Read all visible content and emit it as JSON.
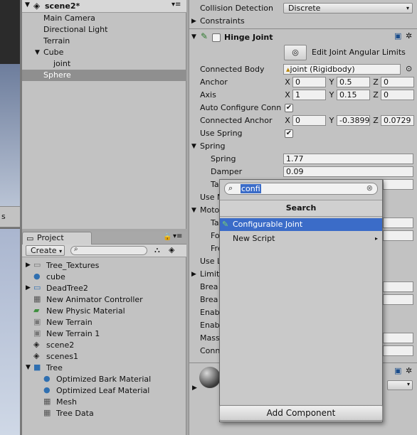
{
  "hierarchy": {
    "scene_name": "scene2*",
    "items": [
      "Main Camera",
      "Directional Light",
      "Terrain",
      "Cube",
      "joint",
      "Sphere"
    ]
  },
  "scene_view": {
    "tool_label": "s"
  },
  "project": {
    "tab": "Project",
    "create": "Create",
    "assets": [
      "Tree_Textures",
      "cube",
      "DeadTree2",
      "New Animator Controller",
      "New Physic Material",
      "New Terrain",
      "New Terrain 1",
      "scene2",
      "scenes1",
      "Tree",
      "Optimized Bark Material",
      "Optimized Leaf Material",
      "Mesh",
      "Tree Data"
    ]
  },
  "inspector": {
    "collision_label": "Collision Detection",
    "collision_value": "Discrete",
    "constraints": "Constraints",
    "component": "Hinge Joint",
    "edit_limits": "Edit Joint Angular Limits",
    "connected_body_label": "Connected Body",
    "connected_body_value": "joint (Rigidbody)",
    "anchor_label": "Anchor",
    "anchor": [
      "0",
      "0.5",
      "0"
    ],
    "axis_label": "Axis",
    "axis": [
      "1",
      "0.15",
      "0"
    ],
    "auto_label": "Auto Configure Conn",
    "auto_checked": true,
    "conn_anchor_label": "Connected Anchor",
    "conn_anchor": [
      "0",
      "-0.3899",
      "0.0729"
    ],
    "use_spring_label": "Use Spring",
    "use_spring_checked": true,
    "spring_header": "Spring",
    "spring_label": "Spring",
    "spring_value": "1.77",
    "damper_label": "Damper",
    "damper_value": "0.09",
    "target_label": "Ta",
    "cut": [
      "Use M",
      "Moto",
      "Ta",
      "Fo",
      "Fre",
      "Use L",
      "Limit",
      "Brea",
      "Brea",
      "Enab",
      "Enab",
      "Mass",
      "Conn"
    ],
    "axes": [
      "X",
      "Y",
      "Z"
    ],
    "add_component": "Add Component"
  },
  "popup": {
    "search_value": "confi",
    "title": "Search",
    "items": [
      "Configurable Joint",
      "New Script"
    ]
  }
}
